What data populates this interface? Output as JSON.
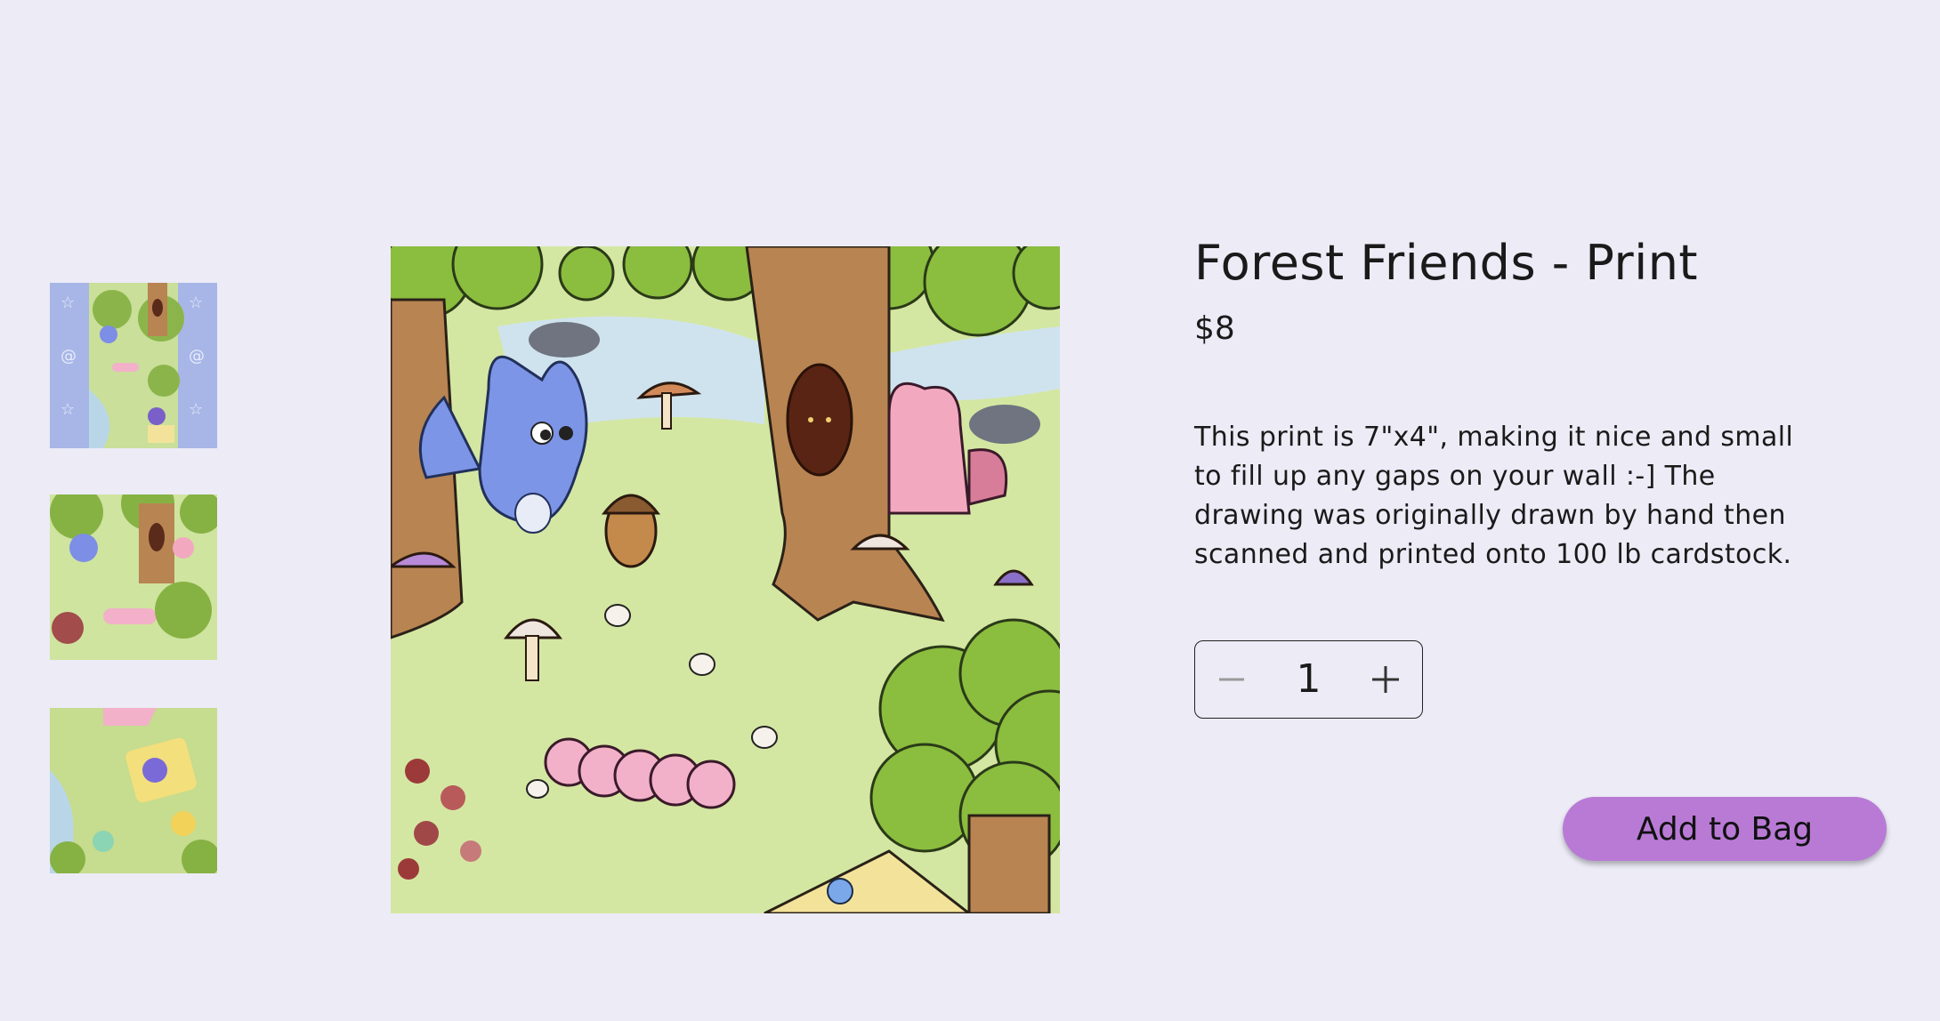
{
  "product": {
    "title": "Forest Friends - Print",
    "price": "$8",
    "description": "This print is 7\"x4\", making it nice and small to fill up any gaps on your wall :-] The drawing was originally drawn by hand then scanned and printed onto 100 lb cardstock."
  },
  "quantity": {
    "value": "1",
    "decrement_icon": "minus-icon",
    "increment_icon": "plus-icon"
  },
  "actions": {
    "add_to_bag_label": "Add to Bag"
  },
  "colors": {
    "background": "#ecebf6",
    "button": "#b97ad6"
  }
}
